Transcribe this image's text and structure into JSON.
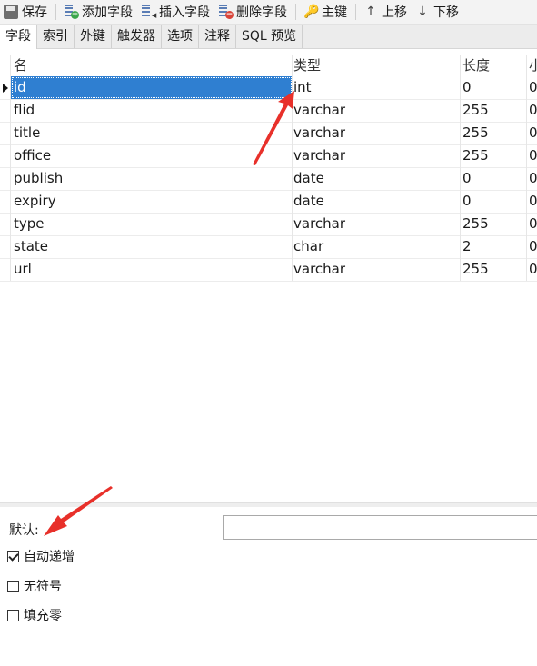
{
  "toolbar": {
    "save": "保存",
    "add_field": "添加字段",
    "insert_field": "插入字段",
    "delete_field": "删除字段",
    "primary_key": "主键",
    "move_up": "上移",
    "move_down": "下移"
  },
  "tabs": [
    {
      "label": "字段"
    },
    {
      "label": "索引"
    },
    {
      "label": "外键"
    },
    {
      "label": "触发器"
    },
    {
      "label": "选项"
    },
    {
      "label": "注释"
    },
    {
      "label": "SQL 预览"
    }
  ],
  "grid": {
    "columns": {
      "name": "名",
      "type": "类型",
      "length": "长度",
      "decimal": "小"
    },
    "rows": [
      {
        "name": "id",
        "type": "int",
        "length": "0",
        "decimal": "0"
      },
      {
        "name": "flid",
        "type": "varchar",
        "length": "255",
        "decimal": "0"
      },
      {
        "name": "title",
        "type": "varchar",
        "length": "255",
        "decimal": "0"
      },
      {
        "name": "office",
        "type": "varchar",
        "length": "255",
        "decimal": "0"
      },
      {
        "name": "publish",
        "type": "date",
        "length": "0",
        "decimal": "0"
      },
      {
        "name": "expiry",
        "type": "date",
        "length": "0",
        "decimal": "0"
      },
      {
        "name": "type",
        "type": "varchar",
        "length": "255",
        "decimal": "0"
      },
      {
        "name": "state",
        "type": "char",
        "length": "2",
        "decimal": "0"
      },
      {
        "name": "url",
        "type": "varchar",
        "length": "255",
        "decimal": "0"
      }
    ]
  },
  "properties": {
    "default_label": "默认:",
    "default_value": "",
    "auto_increment_label": "自动递增",
    "unsigned_label": "无符号",
    "zerofill_label": "填充零"
  },
  "colors": {
    "selection": "#2f7fd1",
    "arrow": "#e8302a"
  }
}
